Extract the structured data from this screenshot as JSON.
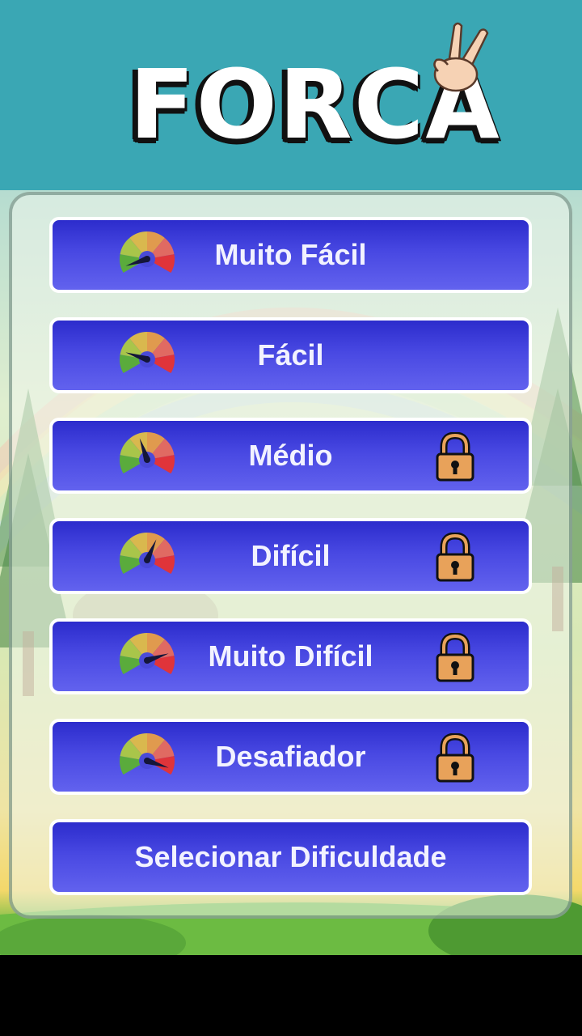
{
  "title": "FORCA",
  "difficulty_levels": [
    {
      "label": "Muito Fácil",
      "gauge_level": 0.05,
      "locked": false
    },
    {
      "label": "Fácil",
      "gauge_level": 0.2,
      "locked": false
    },
    {
      "label": "Médio",
      "gauge_level": 0.42,
      "locked": true
    },
    {
      "label": "Difícil",
      "gauge_level": 0.6,
      "locked": true
    },
    {
      "label": "Muito Difícil",
      "gauge_level": 0.8,
      "locked": true
    },
    {
      "label": "Desafiador",
      "gauge_level": 0.95,
      "locked": true
    }
  ],
  "select_button": {
    "label": "Selecionar Dificuldade"
  },
  "icons": {
    "header": "peace-hand-icon",
    "gauge": "speedometer-icon",
    "lock": "padlock-icon"
  },
  "colors": {
    "header_bg": "#3aa7b4",
    "button_top": "#2c2ccc",
    "button_bottom": "#6262ee",
    "button_border": "#ffffff",
    "lock_fill": "#e8a25a"
  }
}
